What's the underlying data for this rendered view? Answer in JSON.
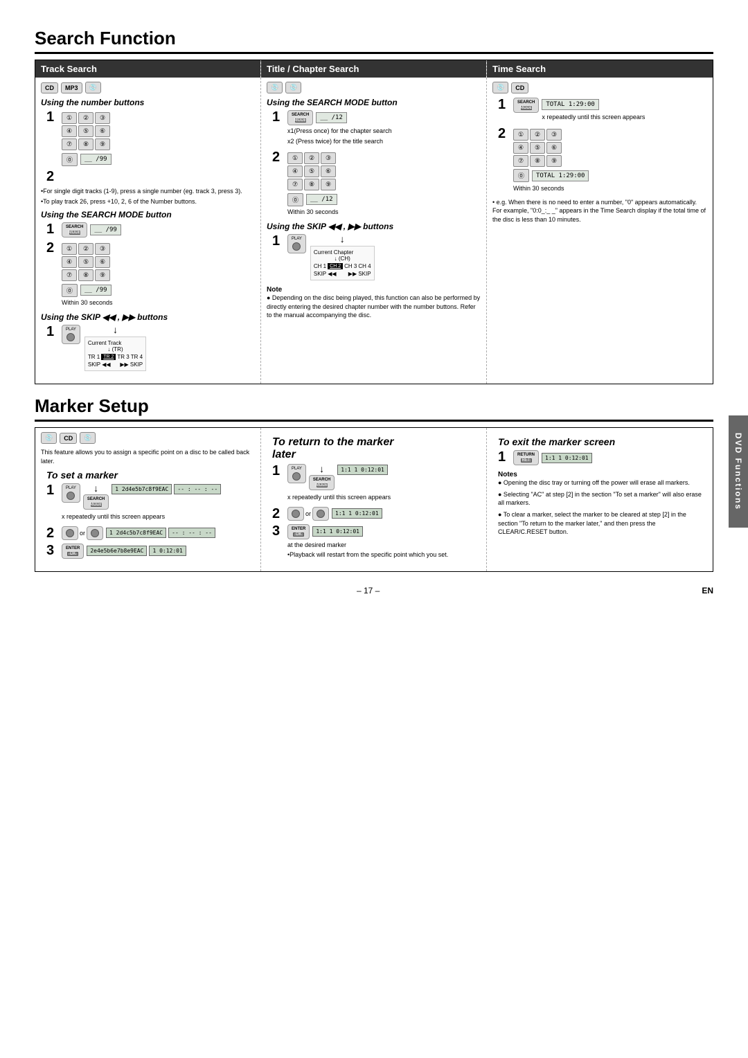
{
  "page": {
    "title": "Search Function",
    "page_number": "– 17 –",
    "lang": "EN",
    "section2_title": "Marker Setup"
  },
  "search_section": {
    "columns": [
      {
        "id": "track",
        "header": "Track Search",
        "devices": [
          "CD",
          "MP3",
          "DVD"
        ],
        "subsections": [
          {
            "title": "Using the number buttons",
            "steps": [
              {
                "num": "1",
                "desc": "Enter track numbers using number buttons"
              },
              {
                "num": "2",
                "desc": ""
              }
            ],
            "bullets": [
              "•For single digit tracks (1-9), press a single number (eg. track 3, press 3).",
              "•To play track 26, press +10, 2, 6 of the Number buttons."
            ]
          },
          {
            "title": "Using the SEARCH MODE button",
            "steps": [
              {
                "num": "1",
                "desc": ""
              },
              {
                "num": "2",
                "desc": "Within 30 seconds"
              }
            ]
          },
          {
            "title": "Using the SKIP ◀◀ , ▶▶ buttons",
            "steps": [
              {
                "num": "1",
                "desc": "Current Track\n↓ (TR)\nTR1 TR2 TR3 TR4\nSKIP◀◀       ▶▶SKIP"
              }
            ]
          }
        ]
      },
      {
        "id": "title_chapter",
        "header": "Title / Chapter Search",
        "devices": [
          "DVD",
          "DVD"
        ],
        "subsections": [
          {
            "title": "Using the SEARCH MODE button",
            "steps": [
              {
                "num": "1",
                "desc": ""
              }
            ],
            "extra": [
              "x1(Press once) for the chapter search",
              "x2 (Press twice) for the title search"
            ]
          },
          {
            "title": "",
            "steps": [
              {
                "num": "2",
                "desc": "Within 30 seconds"
              }
            ]
          },
          {
            "title": "Using the SKIP ◀◀ , ▶▶ buttons",
            "steps": [
              {
                "num": "1",
                "desc": "Current Chapter\n↓ (CH)\nCH1 CH2 CH3 CH4\nSKIP◀◀       ▶▶SKIP"
              }
            ],
            "note": {
              "title": "Note",
              "text": "● Depending on the disc being played, this function can also be performed by directly entering the desired chapter number with the number buttons. Refer to the manual accompanying the disc."
            }
          }
        ]
      },
      {
        "id": "time",
        "header": "Time Search",
        "devices": [
          "DVD",
          "CD"
        ],
        "subsections": [
          {
            "steps": [
              {
                "num": "1",
                "desc": "x repeatedly until this screen appears",
                "display": "1:29:00"
              },
              {
                "num": "2",
                "desc": "Within 30 seconds",
                "display": "1:29:00"
              }
            ],
            "note": {
              "text": "• e.g. When there is no need to enter a number, \"0\" appears automatically. For example, \"0:0_:_ _\" appears in the Time Search display if the total time of the disc is less than 10 minutes."
            }
          }
        ]
      }
    ]
  },
  "marker_section": {
    "title": "Marker Setup",
    "devices": [
      "DVD",
      "CD",
      "DVD"
    ],
    "columns": [
      {
        "id": "set_marker",
        "intro": "This feature allows you to assign a specific point on a disc to be called back later.",
        "title": "To set a marker",
        "steps": [
          {
            "num": "1",
            "desc": "x repeatedly until this screen appears",
            "display": "1 2d4e5b7c8f9EAC\n-- : -- : --"
          },
          {
            "num": "2",
            "desc": "or",
            "display": "1 2d4c5b7c8f9EAC\n-- : -- : --"
          },
          {
            "num": "3",
            "desc": "",
            "display": "2e4e5b6e7b8e9EAC\n1 0:12:01"
          }
        ]
      },
      {
        "id": "return_marker",
        "title": "To return to the marker later",
        "steps": [
          {
            "num": "1",
            "desc": "x repeatedly until this screen appears",
            "display": "1:1 1 0:12:01"
          },
          {
            "num": "2",
            "desc": "or",
            "display": "1:1 1 0:12:01"
          },
          {
            "num": "3",
            "desc": "at the desired marker",
            "display": "1:1 1 0:12:01",
            "extra": "•Playback will restart from the specific point which you set."
          }
        ]
      },
      {
        "id": "exit_marker",
        "title": "To exit the marker screen",
        "steps": [
          {
            "num": "1",
            "desc": "",
            "display": "1:1 1 0:12:01"
          }
        ],
        "notes": {
          "title": "Notes",
          "items": [
            "● Opening the disc tray or turning off the power will erase all markers.",
            "● Selecting \"AC\" at step [2] in the section \"To set a marker\" will also erase all markers.",
            "● To clear a marker, select the marker to be cleared at step [2] in the section \"To return to the marker later,\" and then press the CLEAR/C.RESET button."
          ]
        }
      }
    ]
  }
}
